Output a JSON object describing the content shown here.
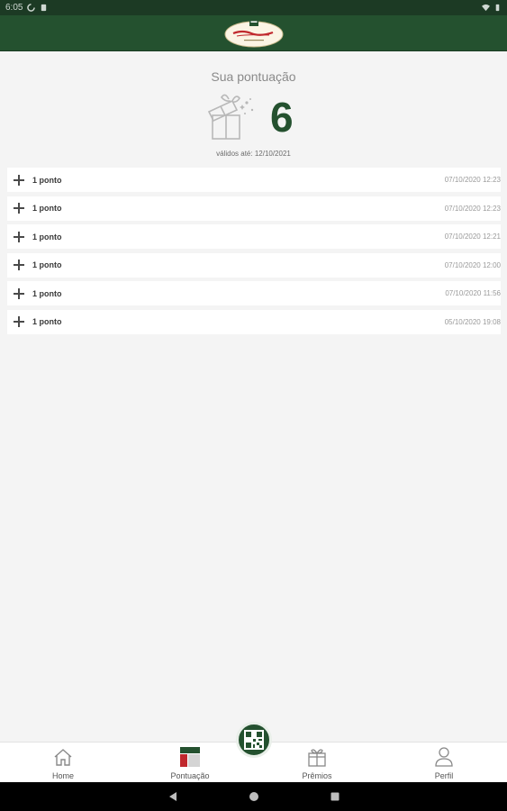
{
  "status_bar": {
    "time": "6:05"
  },
  "header": {
    "logo_alt": "Fornadaria"
  },
  "score": {
    "title": "Sua pontuação",
    "value": "6",
    "valid_until": "válidos até: 12/10/2021"
  },
  "entries": [
    {
      "label": "1 ponto",
      "date": "07/10/2020 12:23"
    },
    {
      "label": "1 ponto",
      "date": "07/10/2020 12:23"
    },
    {
      "label": "1 ponto",
      "date": "07/10/2020 12:21"
    },
    {
      "label": "1 ponto",
      "date": "07/10/2020 12:00"
    },
    {
      "label": "1 ponto",
      "date": "07/10/2020 11:56"
    },
    {
      "label": "1 ponto",
      "date": "05/10/2020 19:08"
    }
  ],
  "bottom_nav": {
    "items": [
      {
        "label": "Home",
        "icon": "home-icon"
      },
      {
        "label": "Pontuação",
        "icon": "points-icon"
      },
      {
        "label": "Prêmios",
        "icon": "gift-icon"
      },
      {
        "label": "Perfil",
        "icon": "person-icon"
      }
    ],
    "fab_icon": "qr-code-icon"
  },
  "colors": {
    "brand_green": "#24512f",
    "status_bar": "#1c3a24",
    "accent_red": "#c0282d",
    "background": "#f4f4f4"
  }
}
